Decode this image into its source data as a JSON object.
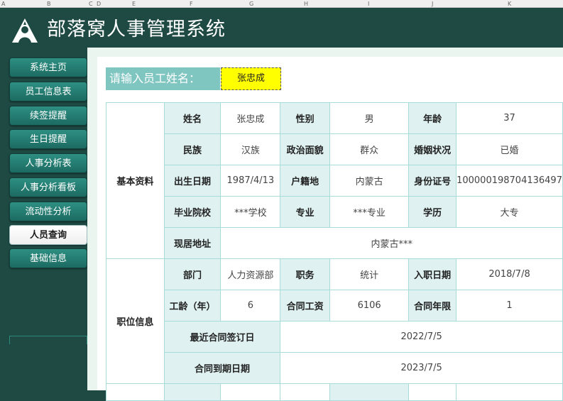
{
  "spreadsheet_columns": [
    "A",
    "B",
    "C",
    "D",
    "E",
    "F",
    "G",
    "H",
    "I",
    "J",
    "K"
  ],
  "app": {
    "title": "部落窝人事管理系统"
  },
  "nav": {
    "items": [
      {
        "label": "系统主页"
      },
      {
        "label": "员工信息表"
      },
      {
        "label": "续签提醒"
      },
      {
        "label": "生日提醒"
      },
      {
        "label": "人事分析表"
      },
      {
        "label": "人事分析看板"
      },
      {
        "label": "流动性分析"
      },
      {
        "label": "人员查询"
      },
      {
        "label": "基础信息"
      }
    ],
    "active": "人员查询"
  },
  "search": {
    "label": "请输入员工姓名：",
    "value": "张忠成"
  },
  "basic": {
    "section_label": "基本资料",
    "name_label": "姓名",
    "name": "张忠成",
    "gender_label": "性别",
    "gender": "男",
    "age_label": "年龄",
    "age": "37",
    "ethnicity_label": "民族",
    "ethnicity": "汉族",
    "political_label": "政治面貌",
    "political": "群众",
    "marital_label": "婚姻状况",
    "marital": "已婚",
    "birth_label": "出生日期",
    "birth": "1987/4/13",
    "hukou_label": "户籍地",
    "hukou": "内蒙古",
    "id_label": "身份证号",
    "id": "100000198704136497",
    "school_label": "毕业院校",
    "school": "***学校",
    "major_label": "专业",
    "major": "***专业",
    "edu_label": "学历",
    "edu": "大专",
    "address_label": "现居地址",
    "address": "内蒙古***"
  },
  "job": {
    "section_label": "职位信息",
    "dept_label": "部门",
    "dept": "人力资源部",
    "position_label": "职务",
    "position": "统计",
    "hire_label": "入职日期",
    "hire": "2018/7/8",
    "tenure_label": "工龄（年）",
    "tenure": "6",
    "salary_label": "合同工资",
    "salary": "6106",
    "term_label": "合同年限",
    "term": "1",
    "recent_sign_label": "最近合同签订日",
    "recent_sign": "2022/7/5",
    "expire_label": "合同到期日期",
    "expire": "2023/7/5"
  }
}
